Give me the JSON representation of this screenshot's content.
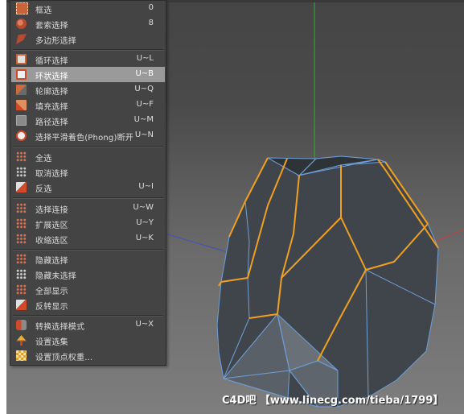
{
  "menu": {
    "items": [
      {
        "label": "框选",
        "shortcut": "0",
        "icon": "rect-select-icon"
      },
      {
        "label": "套索选择",
        "shortcut": "8",
        "icon": "lasso-select-icon"
      },
      {
        "label": "多边形选择",
        "shortcut": "",
        "icon": "polygon-select-icon"
      },
      {
        "label": "循环选择",
        "shortcut": "U~L",
        "icon": "loop-select-icon"
      },
      {
        "label": "环状选择",
        "shortcut": "U~B",
        "icon": "ring-select-icon",
        "highlighted": true
      },
      {
        "label": "轮廓选择",
        "shortcut": "U~Q",
        "icon": "outline-select-icon"
      },
      {
        "label": "填充选择",
        "shortcut": "U~F",
        "icon": "fill-select-icon"
      },
      {
        "label": "路径选择",
        "shortcut": "U~M",
        "icon": "path-select-icon"
      },
      {
        "label": "选择平滑着色(Phong)断开",
        "shortcut": "U~N",
        "icon": "phong-break-icon"
      },
      {
        "label": "全选",
        "shortcut": "",
        "icon": "select-all-icon"
      },
      {
        "label": "取消选择",
        "shortcut": "",
        "icon": "deselect-icon"
      },
      {
        "label": "反选",
        "shortcut": "U~I",
        "icon": "invert-select-icon"
      },
      {
        "label": "选择连接",
        "shortcut": "U~W",
        "icon": "select-connected-icon"
      },
      {
        "label": "扩展选区",
        "shortcut": "U~Y",
        "icon": "grow-select-icon"
      },
      {
        "label": "收缩选区",
        "shortcut": "U~K",
        "icon": "shrink-select-icon"
      },
      {
        "label": "隐藏选择",
        "shortcut": "",
        "icon": "hide-selected-icon"
      },
      {
        "label": "隐藏未选择",
        "shortcut": "",
        "icon": "hide-unselected-icon"
      },
      {
        "label": "全部显示",
        "shortcut": "",
        "icon": "unhide-all-icon"
      },
      {
        "label": "反转显示",
        "shortcut": "",
        "icon": "invert-visibility-icon"
      },
      {
        "label": "转换选择模式",
        "shortcut": "U~X",
        "icon": "convert-selection-icon"
      },
      {
        "label": "设置选集",
        "shortcut": "",
        "icon": "set-selection-icon"
      },
      {
        "label": "设置顶点权重...",
        "shortcut": "",
        "icon": "vertex-weight-icon"
      }
    ]
  },
  "watermark": "C4D吧 【www.linecg.com/tieba/1799】",
  "colors": {
    "menu_bg": "#444444",
    "highlight": "#9a9a9a",
    "selected_edge": "#f0a020",
    "mesh_edge": "#6f9fd8",
    "mesh_face": "#40454c",
    "axis_y": "#2fb02f",
    "axis_x": "#c84040",
    "axis_z": "#4050c0"
  }
}
